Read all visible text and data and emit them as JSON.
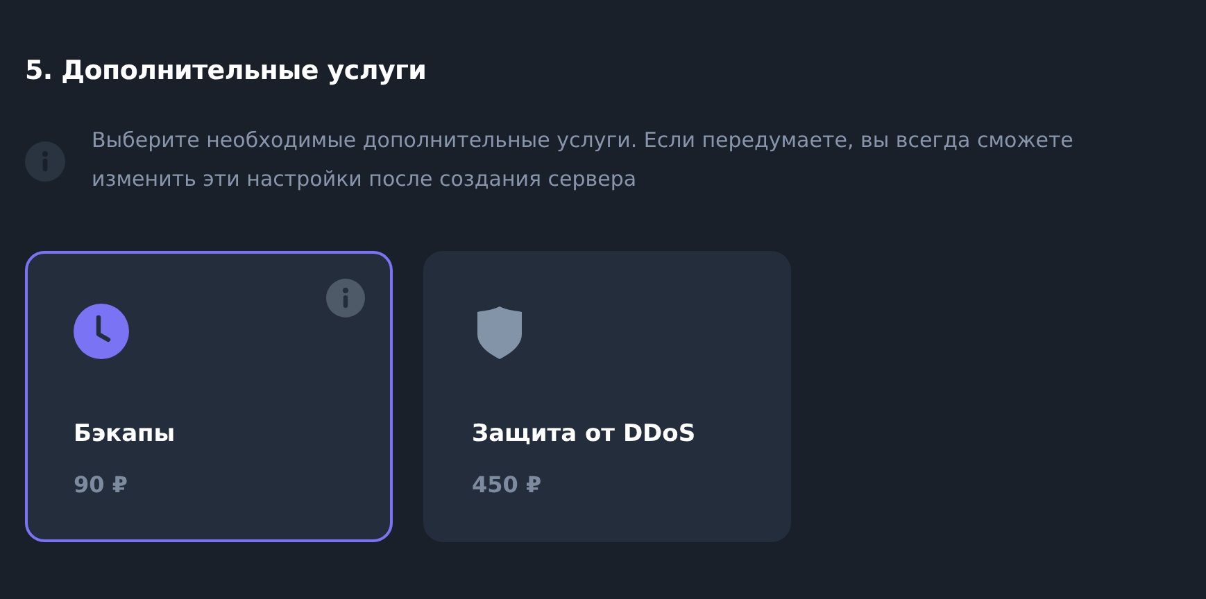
{
  "title": "5. Дополнительные услуги",
  "hint": "Выберите необходимые дополнительные услуги. Если передумаете, вы всегда сможете изменить эти настройки после создания сервера",
  "services": [
    {
      "kind": "clock",
      "name": "Бэкапы",
      "price": "90 ₽",
      "selected": true,
      "info": true
    },
    {
      "kind": "shield",
      "name": "Защита от DDoS",
      "price": "450 ₽",
      "selected": false,
      "info": false
    }
  ]
}
